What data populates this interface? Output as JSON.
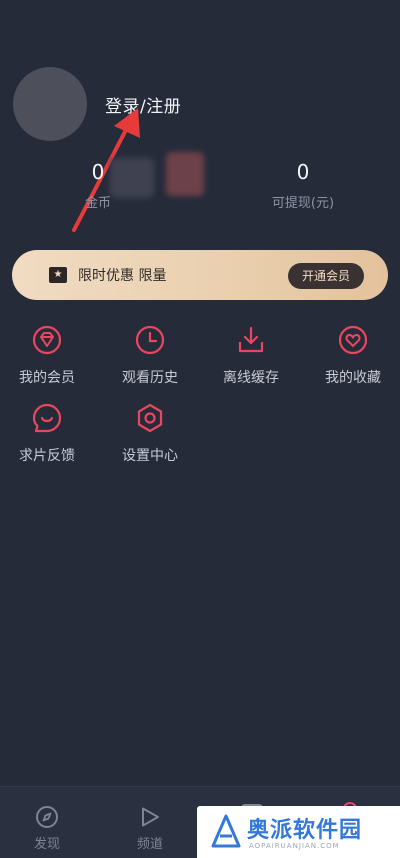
{
  "header": {
    "login_label": "登录/注册"
  },
  "stats": [
    {
      "value": "0",
      "label": "金币"
    },
    {
      "value": "0",
      "label": "可提现(元)"
    }
  ],
  "vip_banner": {
    "text": "限时优惠 限量",
    "button": "开通会员"
  },
  "menu": [
    {
      "label": "我的会员",
      "icon": "diamond-icon"
    },
    {
      "label": "观看历史",
      "icon": "clock-icon"
    },
    {
      "label": "离线缓存",
      "icon": "download-icon"
    },
    {
      "label": "我的收藏",
      "icon": "heart-icon"
    },
    {
      "label": "求片反馈",
      "icon": "feedback-icon"
    },
    {
      "label": "设置中心",
      "icon": "settings-icon"
    }
  ],
  "tabs": [
    {
      "label": "发现",
      "icon": "compass-icon"
    },
    {
      "label": "频道",
      "icon": "play-icon"
    }
  ],
  "watermark": {
    "text": "奥派软件园",
    "sub": "AOPAIRUANJIAN.COM"
  },
  "colors": {
    "background": "#262b3a",
    "accent": "#e8475f",
    "vip_gold": "#ebd3b4",
    "arrow": "#e53b3b"
  }
}
